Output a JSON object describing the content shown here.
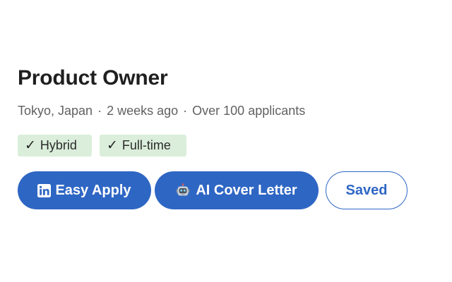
{
  "job": {
    "title": "Product Owner",
    "location": "Tokyo, Japan",
    "posted": "2 weeks ago",
    "applicants": "Over 100 applicants",
    "separator": "·"
  },
  "tags": [
    {
      "label": "Hybrid",
      "icon": "check-icon"
    },
    {
      "label": "Full-time",
      "icon": "check-icon"
    }
  ],
  "check_glyph": "✓",
  "actions": {
    "easy_apply": {
      "label": "Easy Apply",
      "icon": "linkedin-icon"
    },
    "cover_letter": {
      "label": "AI Cover Letter",
      "icon": "robot-icon"
    },
    "saved": {
      "label": "Saved"
    }
  },
  "colors": {
    "primary": "#2e66c4",
    "chip_bg": "#dbeedb",
    "title": "#1f1f1f",
    "meta": "#616161"
  }
}
